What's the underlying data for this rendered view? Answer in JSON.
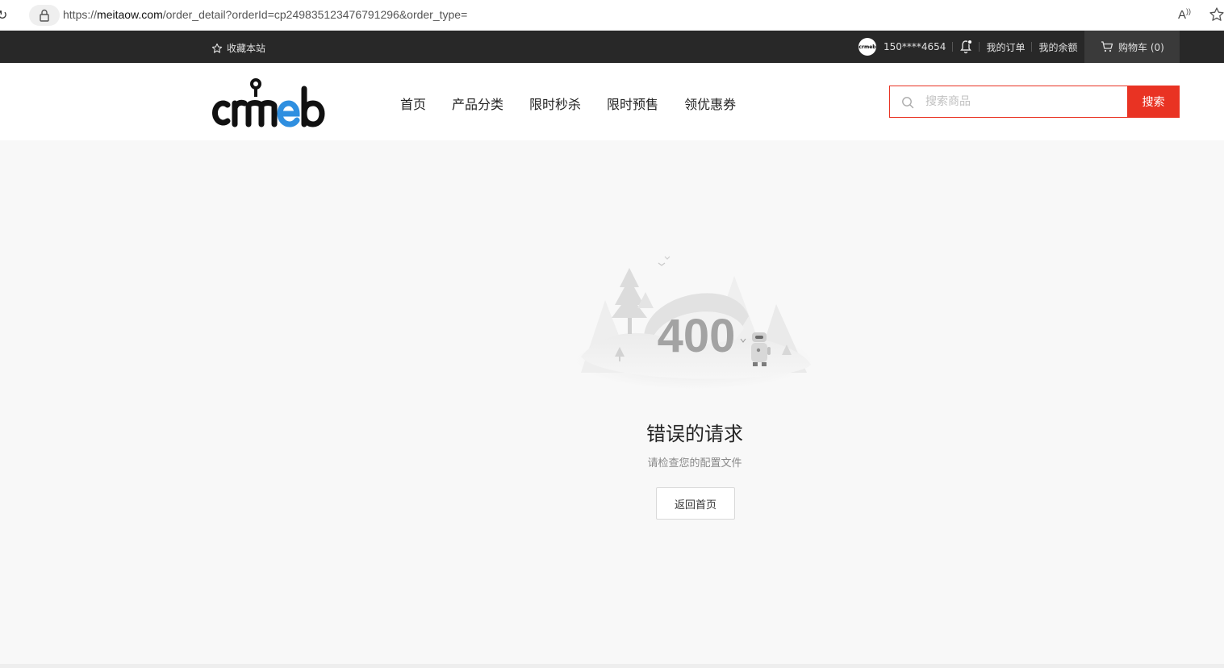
{
  "browser": {
    "url_prefix": "https://",
    "url_domain": "meitaow.com",
    "url_path": "/order_detail?orderId=cp249835123476791296&order_type=",
    "read_aloud_label": "A",
    "icons": [
      "reload-icon",
      "lock-icon",
      "read-aloud-icon",
      "favorite-star-icon"
    ]
  },
  "topbar": {
    "collect_label": "收藏本站",
    "phone": "150****4654",
    "my_orders": "我的订单",
    "my_balance": "我的余额",
    "cart_label": "购物车 (0)",
    "avatar_text": "crmeb"
  },
  "header": {
    "logo_text": "crmeb",
    "nav": [
      "首页",
      "产品分类",
      "限时秒杀",
      "限时预售",
      "领优惠券"
    ],
    "search_placeholder": "搜索商品",
    "search_button": "搜索"
  },
  "error": {
    "code": "400",
    "title": "错误的请求",
    "subtitle": "请检查您的配置文件",
    "home_button": "返回首页"
  },
  "colors": {
    "topbar_bg": "#282828",
    "accent": "#e93323",
    "logo_e": "#2f8fe0",
    "page_bg": "#f8f8f8"
  }
}
